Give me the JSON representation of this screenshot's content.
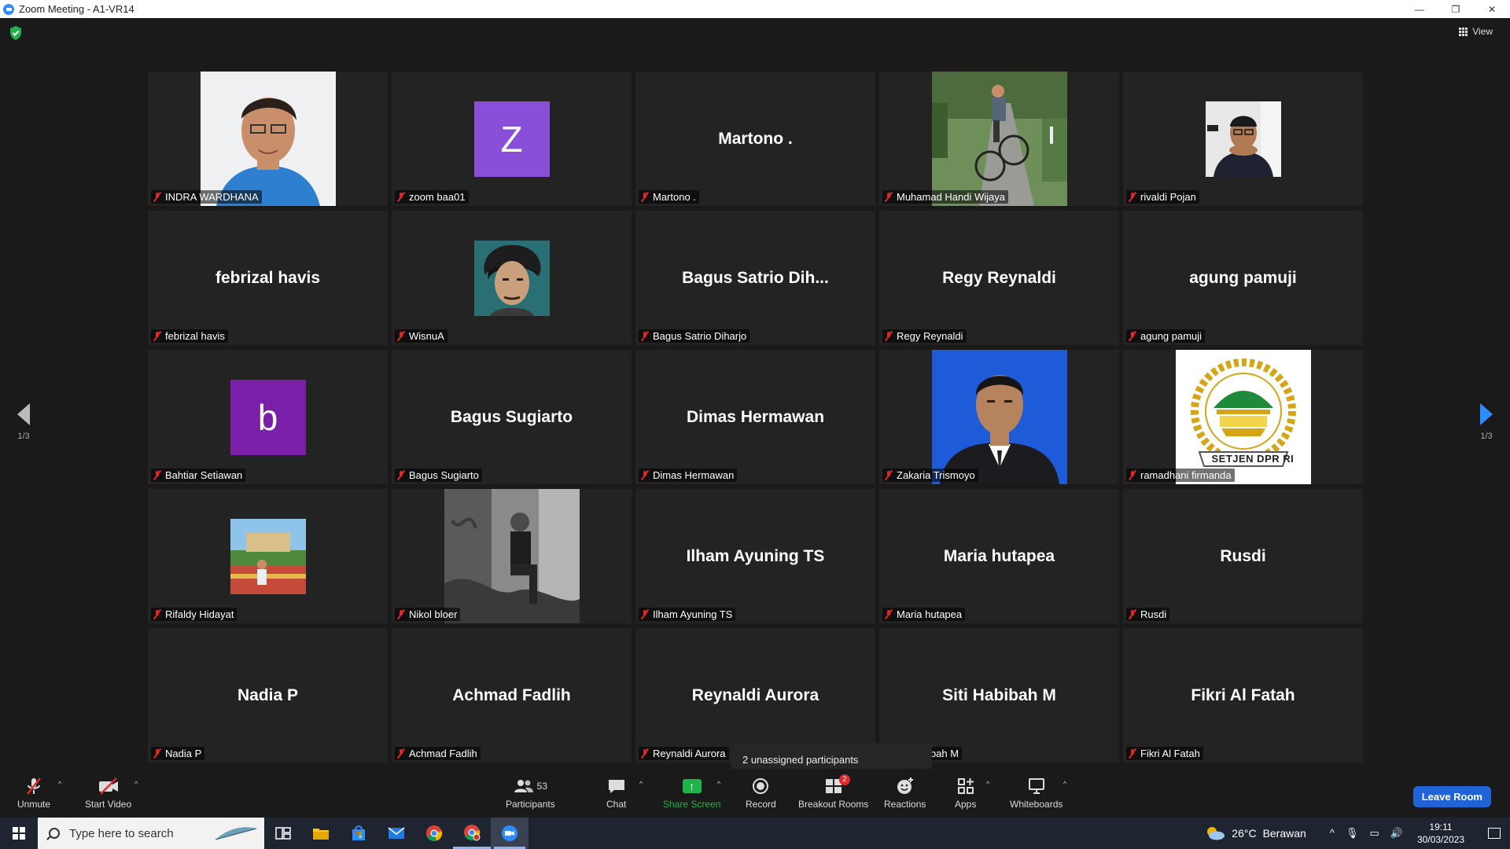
{
  "window": {
    "title": "Zoom Meeting - A1-VR14",
    "controls": [
      "minimize",
      "restore",
      "close"
    ]
  },
  "header": {
    "view_label": "View",
    "page_left": "1/3",
    "page_right": "1/3"
  },
  "tiles": [
    {
      "big": "",
      "name": "INDRA WARDHANA",
      "media": "photo-portrait-indra"
    },
    {
      "big": "",
      "name": "zoom baa01",
      "avatar_letter": "Z",
      "avatar_color": "#8a4fd8"
    },
    {
      "big": "Martono .",
      "name": "Martono ."
    },
    {
      "big": "",
      "name": "Muhamad Handi Wijaya",
      "media": "photo-cyclist"
    },
    {
      "big": "",
      "name": "rivaldi Pojan",
      "media": "photo-rivaldi"
    },
    {
      "big": "febrizal havis",
      "name": "febrizal havis"
    },
    {
      "big": "",
      "name": "WisnuA",
      "media": "photo-wisnu"
    },
    {
      "big": "Bagus Satrio Dih...",
      "name": "Bagus Satrio Diharjo"
    },
    {
      "big": "Regy Reynaldi",
      "name": "Regy Reynaldi"
    },
    {
      "big": "agung pamuji",
      "name": "agung pamuji"
    },
    {
      "big": "",
      "name": "Bahtiar Setiawan",
      "avatar_letter": "b",
      "avatar_color": "#7a1fa8"
    },
    {
      "big": "Bagus Sugiarto",
      "name": "Bagus Sugiarto"
    },
    {
      "big": "Dimas Hermawan",
      "name": "Dimas Hermawan"
    },
    {
      "big": "",
      "name": "Zakaria Trismoyo",
      "media": "photo-zakaria"
    },
    {
      "big": "",
      "name": "ramadhani firmanda",
      "media": "logo-setjen",
      "logo_text": "SETJEN DPR RI"
    },
    {
      "big": "",
      "name": "Rifaldy Hidayat",
      "media": "photo-rifaldy"
    },
    {
      "big": "",
      "name": "Nikol bloer",
      "media": "photo-nikol"
    },
    {
      "big": "Ilham Ayuning TS",
      "name": "Ilham Ayuning TS"
    },
    {
      "big": "Maria hutapea",
      "name": "Maria hutapea"
    },
    {
      "big": "Rusdi",
      "name": "Rusdi"
    },
    {
      "big": "Nadia P",
      "name": "Nadia P"
    },
    {
      "big": "Achmad Fadlih",
      "name": "Achmad Fadlih"
    },
    {
      "big": "Reynaldi Aurora",
      "name": "Reynaldi Aurora"
    },
    {
      "big": "Siti Habibah M",
      "name": "ibah M"
    },
    {
      "big": "Fikri Al Fatah",
      "name": "Fikri Al Fatah"
    }
  ],
  "tooltip": "2 unassigned participants",
  "toolbar": {
    "unmute": "Unmute",
    "start_video": "Start Video",
    "participants": "Participants",
    "participants_count": "53",
    "chat": "Chat",
    "share_screen": "Share Screen",
    "record": "Record",
    "breakout_rooms": "Breakout Rooms",
    "breakout_badge": "2",
    "reactions": "Reactions",
    "apps": "Apps",
    "whiteboards": "Whiteboards",
    "leave": "Leave Room",
    "accent": "#2d8cff",
    "share_color": "#21b34b",
    "leave_color": "#1f63d6",
    "muted_color": "#e02828"
  },
  "taskbar": {
    "search_placeholder": "Type here to search",
    "apps": [
      "task-view",
      "file-explorer",
      "microsoft-store",
      "mail",
      "chrome",
      "chrome-profile",
      "zoom"
    ],
    "weather_temp": "26°C",
    "weather_desc": "Berawan",
    "time": "19:11",
    "date": "30/03/2023"
  }
}
